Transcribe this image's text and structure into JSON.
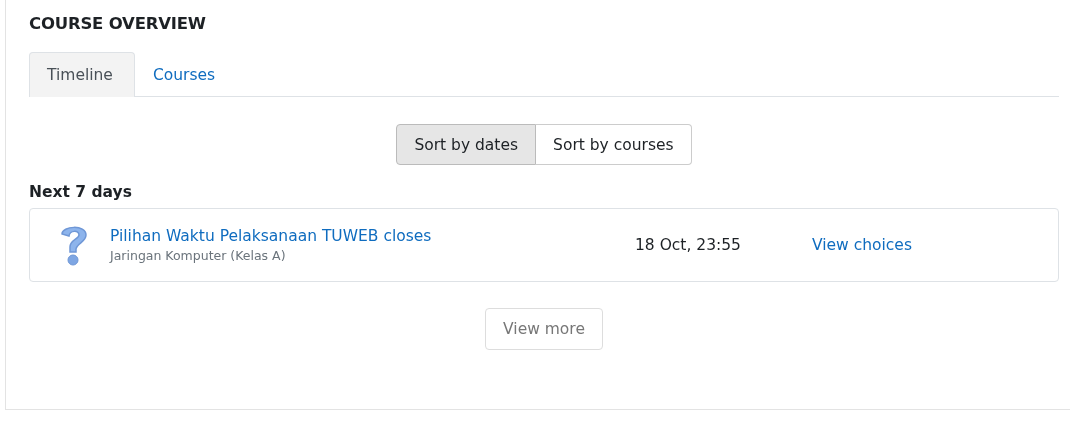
{
  "block": {
    "title": "COURSE OVERVIEW"
  },
  "tabs": [
    {
      "label": "Timeline",
      "selected": true
    },
    {
      "label": "Courses",
      "selected": false
    }
  ],
  "sort_buttons": [
    {
      "label": "Sort by dates",
      "selected": true
    },
    {
      "label": "Sort by courses",
      "selected": false
    }
  ],
  "section": {
    "heading": "Next 7 days"
  },
  "events": [
    {
      "title": "Pilihan Waktu Pelaksanaan TUWEB closes",
      "course": "Jaringan Komputer (Kelas A)",
      "due": "18 Oct, 23:55",
      "action": "View choices"
    }
  ],
  "view_more": {
    "label": "View more",
    "disabled": true
  }
}
